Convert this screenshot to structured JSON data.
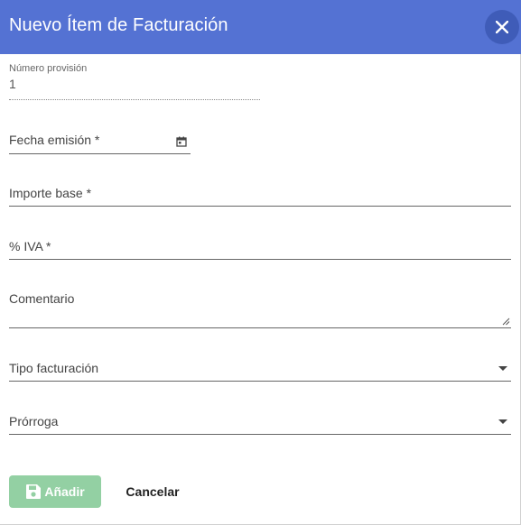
{
  "dialog": {
    "title": "Nuevo Ítem de Facturación",
    "header_color": "#5472d3"
  },
  "fields": {
    "numero_provision": {
      "label": "Número provisión",
      "value": "1"
    },
    "fecha_emision": {
      "label": "Fecha emisión *",
      "icon": "calendar-icon"
    },
    "importe_base": {
      "label": "Importe base *"
    },
    "iva": {
      "label": "% IVA *"
    },
    "comentario": {
      "label": "Comentario"
    },
    "tipo_facturacion": {
      "label": "Tipo facturación",
      "icon": "dropdown-arrow-icon"
    },
    "prorroga": {
      "label": "Prórroga",
      "icon": "dropdown-arrow-icon"
    }
  },
  "actions": {
    "add_label": "Añadir",
    "add_icon": "save-icon",
    "add_color": "#93d0a3",
    "cancel_label": "Cancelar"
  }
}
